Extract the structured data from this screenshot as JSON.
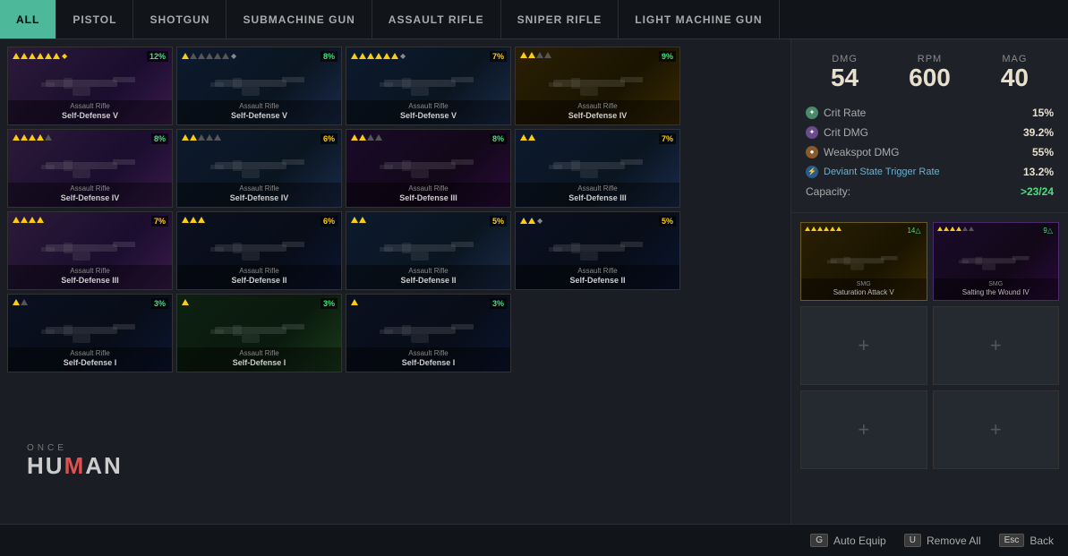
{
  "nav": {
    "tabs": [
      {
        "id": "all",
        "label": "ALL",
        "active": true
      },
      {
        "id": "pistol",
        "label": "PISTOL",
        "active": false
      },
      {
        "id": "shotgun",
        "label": "SHOTGUN",
        "active": false
      },
      {
        "id": "submachine",
        "label": "SUBMACHINE GUN",
        "active": false
      },
      {
        "id": "assault",
        "label": "ASSAULT RIFLE",
        "active": false
      },
      {
        "id": "sniper",
        "label": "SNIPER RIFLE",
        "active": false
      },
      {
        "id": "lmg",
        "label": "LIGHT MACHINE GUN",
        "active": false
      }
    ]
  },
  "stats": {
    "dmg_label": "DMG",
    "dmg_value": "54",
    "rpm_label": "RPM",
    "rpm_value": "600",
    "mag_label": "MAG",
    "mag_value": "40",
    "crit_rate_label": "Crit Rate",
    "crit_rate_value": "15%",
    "crit_dmg_label": "Crit DMG",
    "crit_dmg_value": "39.2%",
    "weakspot_label": "Weakspot DMG",
    "weakspot_value": "55%",
    "deviant_label": "Deviant State Trigger Rate",
    "deviant_value": "13.2%",
    "capacity_label": "Capacity:",
    "capacity_value": ">23/24"
  },
  "slots": {
    "slot1": {
      "filled": true,
      "type": "SMG",
      "name": "Saturation Attack V",
      "badge": "14△",
      "bg": "yellow",
      "stars": 6
    },
    "slot2": {
      "filled": true,
      "type": "SMG",
      "name": "Salting the Wound IV",
      "badge": "9△",
      "bg": "purple",
      "stars": 5
    },
    "slot3": {
      "filled": false
    },
    "slot4": {
      "filled": false
    },
    "slot5": {
      "filled": false
    },
    "slot6": {
      "filled": false
    }
  },
  "weapons": [
    {
      "row": 0,
      "col": 0,
      "type": "Assault Rifle",
      "name": "Self-Defense V",
      "stars": 6,
      "extra_star": true,
      "badge": "12%",
      "badge_color": "green",
      "bg": "purple"
    },
    {
      "row": 0,
      "col": 1,
      "type": "Assault Rifle",
      "name": "Self-Defense V",
      "stars": 4,
      "extra_star": false,
      "badge": "8%",
      "badge_color": "green",
      "bg": "blue"
    },
    {
      "row": 0,
      "col": 2,
      "type": "Assault Rifle",
      "name": "Self-Defense V",
      "stars": 6,
      "extra_star": false,
      "badge": "7%",
      "badge_color": "yellow",
      "bg": "blue"
    },
    {
      "row": 0,
      "col": 3,
      "type": "Assault Rifle",
      "name": "Self-Defense IV",
      "stars": 3,
      "extra_star": false,
      "badge": "9%",
      "badge_color": "green",
      "bg": "yellow"
    },
    {
      "row": 1,
      "col": 0,
      "type": "Assault Rifle",
      "name": "Self-Defense IV",
      "stars": 5,
      "extra_star": false,
      "badge": "8%",
      "badge_color": "green",
      "bg": "purple"
    },
    {
      "row": 1,
      "col": 1,
      "type": "Assault Rifle",
      "name": "Self-Defense IV",
      "stars": 3,
      "extra_star": false,
      "badge": "6%",
      "badge_color": "yellow",
      "bg": "blue"
    },
    {
      "row": 1,
      "col": 2,
      "type": "Assault Rifle",
      "name": "Self-Defense III",
      "stars": 3,
      "extra_star": false,
      "badge": "8%",
      "badge_color": "green",
      "bg": "dark-purple"
    },
    {
      "row": 1,
      "col": 3,
      "type": "Assault Rifle",
      "name": "Self-Defense III",
      "stars": 2,
      "extra_star": false,
      "badge": "7%",
      "badge_color": "yellow",
      "bg": "blue"
    },
    {
      "row": 2,
      "col": 0,
      "type": "Assault Rifle",
      "name": "Self-Defense III",
      "stars": 4,
      "extra_star": false,
      "badge": "7%",
      "badge_color": "yellow",
      "bg": "purple"
    },
    {
      "row": 2,
      "col": 1,
      "type": "Assault Rifle",
      "name": "Self-Defense II",
      "stars": 3,
      "extra_star": false,
      "badge": "6%",
      "badge_color": "yellow",
      "bg": "dark-blue"
    },
    {
      "row": 2,
      "col": 2,
      "type": "Assault Rifle",
      "name": "Self-Defense II",
      "stars": 2,
      "extra_star": false,
      "badge": "5%",
      "badge_color": "yellow",
      "bg": "blue"
    },
    {
      "row": 2,
      "col": 3,
      "type": "Assault Rifle",
      "name": "Self-Defense II",
      "stars": 2,
      "extra_star": false,
      "badge": "5%",
      "badge_color": "yellow",
      "bg": "dark-blue"
    },
    {
      "row": 3,
      "col": 0,
      "type": "Assault Rifle",
      "name": "Self-Defense I",
      "stars": 1,
      "extra_star": false,
      "badge": "3%",
      "badge_color": "green",
      "bg": "dark-blue"
    },
    {
      "row": 3,
      "col": 1,
      "type": "Assault Rifle",
      "name": "Self-Defense I",
      "stars": 1,
      "extra_star": false,
      "badge": "3%",
      "badge_color": "green",
      "bg": "green"
    },
    {
      "row": 3,
      "col": 2,
      "type": "Assault Rifle",
      "name": "Self-Defense I",
      "stars": 1,
      "extra_star": false,
      "badge": "3%",
      "badge_color": "green",
      "bg": "dark-blue"
    }
  ],
  "bottom": {
    "auto_equip_key": "G",
    "auto_equip_label": "Auto Equip",
    "remove_all_key": "U",
    "remove_all_label": "Remove All",
    "back_key": "Esc",
    "back_label": "Back"
  },
  "logo": {
    "once": "ONCE",
    "human": "HUMAN"
  }
}
